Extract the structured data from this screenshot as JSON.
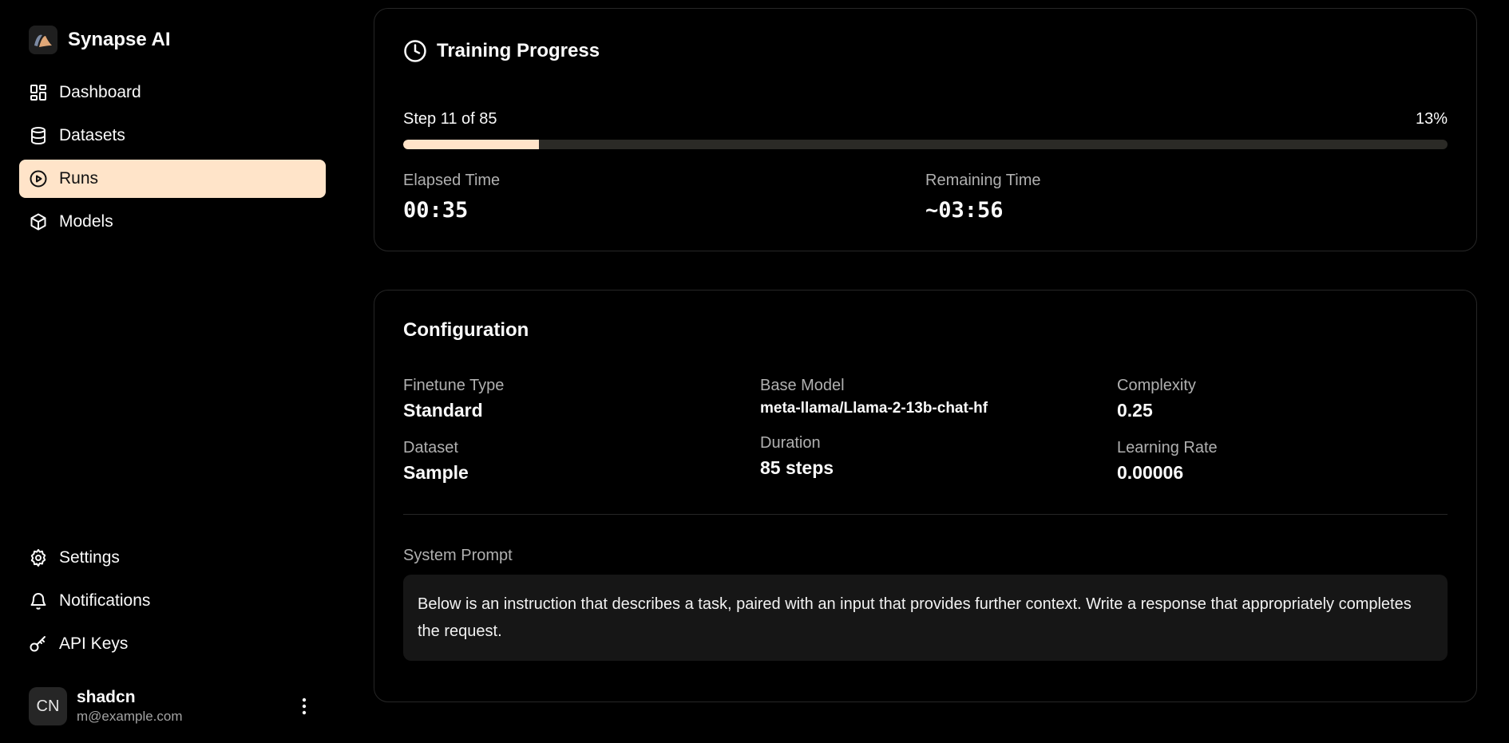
{
  "brand": {
    "name": "Synapse AI",
    "icon": "synapse-logo"
  },
  "nav": {
    "items": [
      {
        "label": "Dashboard",
        "icon": "dashboard-icon"
      },
      {
        "label": "Datasets",
        "icon": "database-icon"
      },
      {
        "label": "Runs",
        "icon": "play-circle-icon",
        "active": true
      },
      {
        "label": "Models",
        "icon": "cube-icon"
      }
    ],
    "bottom_items": [
      {
        "label": "Settings",
        "icon": "gear-icon"
      },
      {
        "label": "Notifications",
        "icon": "bell-icon"
      },
      {
        "label": "API Keys",
        "icon": "key-icon"
      }
    ]
  },
  "user": {
    "initials": "CN",
    "name": "shadcn",
    "email": "m@example.com"
  },
  "progress": {
    "title": "Training Progress",
    "step_text": "Step 11 of 85",
    "percent_text": "13%",
    "fraction": 0.13,
    "elapsed_label": "Elapsed Time",
    "elapsed_value": "00:35",
    "remaining_label": "Remaining Time",
    "remaining_value": "~03:56"
  },
  "config": {
    "title": "Configuration",
    "fields": [
      {
        "label": "Finetune Type",
        "value": "Standard"
      },
      {
        "label": "Base Model",
        "value": "meta-llama/Llama-2-13b-chat-hf"
      },
      {
        "label": "Complexity",
        "value": "0.25"
      },
      {
        "label": "Dataset",
        "value": "Sample"
      },
      {
        "label": "Duration",
        "value": "85 steps"
      },
      {
        "label": "Learning Rate",
        "value": "0.00006"
      }
    ],
    "system_prompt_label": "System Prompt",
    "system_prompt": "Below is an instruction that describes a task, paired with an input that provides further context. Write a response that appropriately completes the request."
  },
  "colors": {
    "accent": "#ffe4c9",
    "background": "#000000",
    "border": "#262626",
    "muted_text": "#b0b0b0"
  }
}
